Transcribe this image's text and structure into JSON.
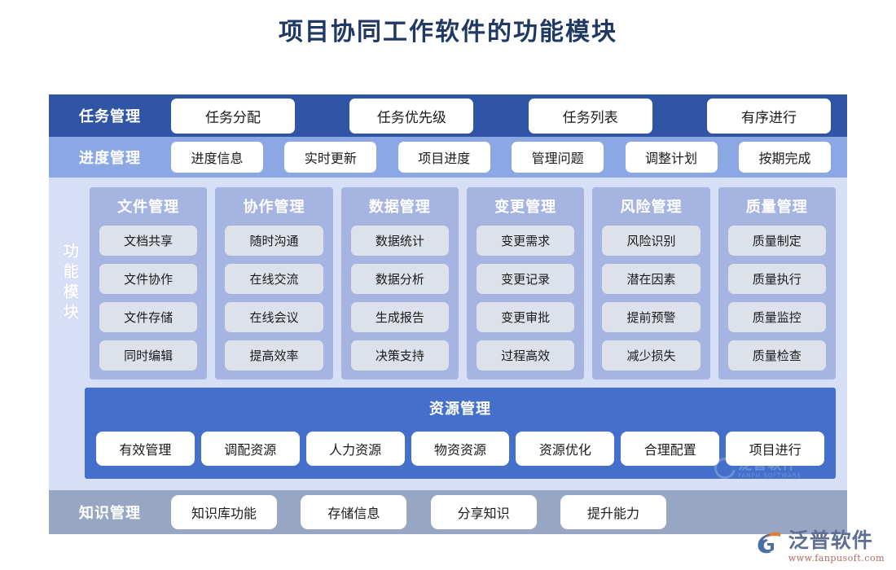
{
  "page": {
    "title": "项目协同工作软件的功能模块"
  },
  "colors": {
    "title": "#1f3864",
    "task_band": "#2f55a4",
    "progress_band": "#8ca8e4",
    "panel_bg": "#d6dff5",
    "module_card": "#a6b4e2",
    "module_item": "#dde2ea",
    "resource_panel": "#4470cb",
    "knowledge_band": "#97a6c3",
    "pill": "#ffffff"
  },
  "bands": {
    "task": {
      "label": "任务管理",
      "items": [
        "任务分配",
        "任务优先级",
        "任务列表",
        "有序进行"
      ]
    },
    "progress": {
      "label": "进度管理",
      "items": [
        "进度信息",
        "实时更新",
        "项目进度",
        "管理问题",
        "调整计划",
        "按期完成"
      ]
    },
    "knowledge": {
      "label": "知识管理",
      "items": [
        "知识库功能",
        "存储信息",
        "分享知识",
        "提升能力"
      ]
    }
  },
  "modules": {
    "side_label": "功能模块",
    "columns": [
      {
        "title": "文件管理",
        "items": [
          "文档共享",
          "文件协作",
          "文件存储",
          "同时编辑"
        ]
      },
      {
        "title": "协作管理",
        "items": [
          "随时沟通",
          "在线交流",
          "在线会议",
          "提高效率"
        ]
      },
      {
        "title": "数据管理",
        "items": [
          "数据统计",
          "数据分析",
          "生成报告",
          "决策支持"
        ]
      },
      {
        "title": "变更管理",
        "items": [
          "变更需求",
          "变更记录",
          "变更审批",
          "过程高效"
        ]
      },
      {
        "title": "风险管理",
        "items": [
          "风险识别",
          "潜在因素",
          "提前预警",
          "减少损失"
        ]
      },
      {
        "title": "质量管理",
        "items": [
          "质量制定",
          "质量执行",
          "质量监控",
          "质量检查"
        ]
      }
    ]
  },
  "resource": {
    "title": "资源管理",
    "items": [
      "有效管理",
      "调配资源",
      "人力资源",
      "物资资源",
      "资源优化",
      "合理配置",
      "项目进行"
    ]
  },
  "watermark": {
    "name": "泛普软件",
    "sub": "FANPU SOFTWARE"
  },
  "logo": {
    "name": "泛普软件",
    "url": "www.fanpusoft.com"
  }
}
